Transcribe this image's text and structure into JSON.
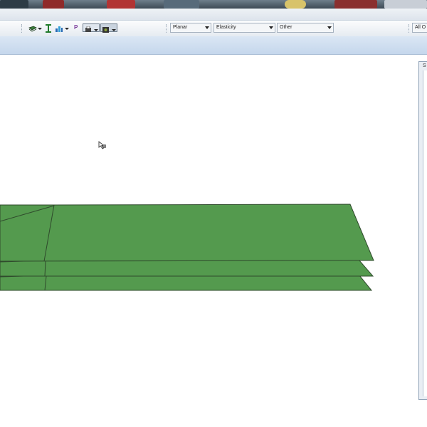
{
  "toolbar": {
    "combos": [
      {
        "name": "planar-combo",
        "value": "Planar"
      },
      {
        "name": "elasticity-combo",
        "value": "Elasticity"
      },
      {
        "name": "other-combo",
        "value": "Other"
      }
    ],
    "filter_value": "All O",
    "pen_label": "P"
  },
  "side_panel": {
    "label": "S"
  },
  "colors": {
    "plate_fill": "#549a4e",
    "plate_edge": "#2f4a2c",
    "toolbar_bg": "#eef2f6",
    "ribbon_bg": "#cfdff0"
  }
}
